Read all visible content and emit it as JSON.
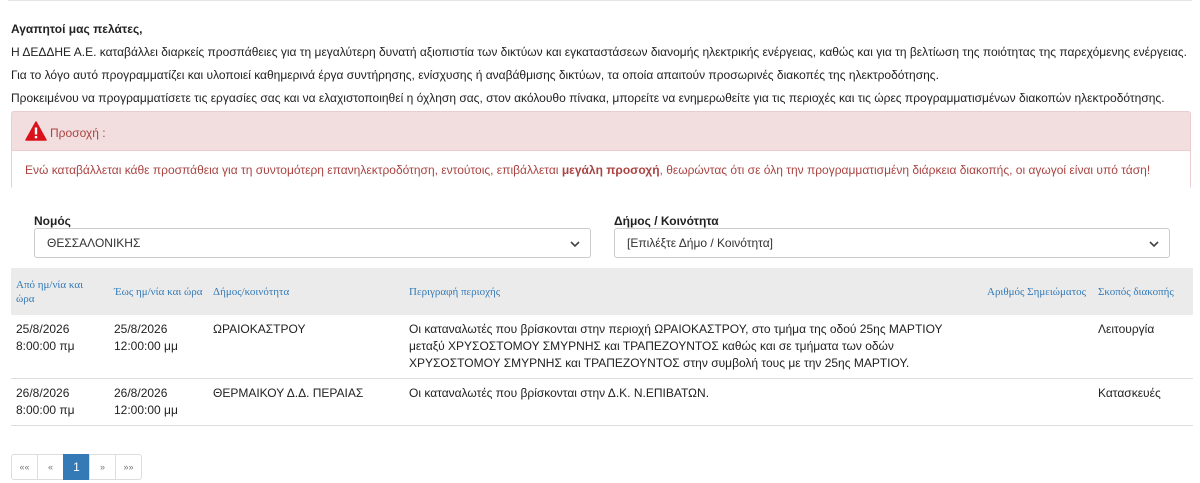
{
  "intro": {
    "greeting": "Αγαπητοί μας πελάτες,",
    "p1": "Η ΔΕΔΔΗΕ Α.Ε. καταβάλλει διαρκείς προσπάθειες για τη μεγαλύτερη δυνατή αξιοπιστία των δικτύων και εγκαταστάσεων διανομής ηλεκτρικής ενέργειας, καθώς και για τη βελτίωση της ποιότητας της παρεχόμενης ενέργειας.",
    "p2": "Για το λόγο αυτό προγραμματίζει και υλοποιεί καθημερινά έργα συντήρησης, ενίσχυσης ή αναβάθμισης δικτύων, τα οποία απαιτούν προσωρινές διακοπές της ηλεκτροδότησης.",
    "p3": "Προκειμένου να προγραμματίσετε τις εργασίες σας και να ελαχιστοποιηθεί η όχληση σας, στον ακόλουθο πίνακα, μπορείτε να ενημερωθείτε για τις περιοχές και τις ώρες προγραμματισμένων διακοπών ηλεκτροδότησης."
  },
  "alert": {
    "icon": "warning-icon",
    "title": "Προσοχή :",
    "msg_before": "Ενώ καταβάλλεται κάθε προσπάθεια για τη συντομότερη επανηλεκτροδότηση, εντούτοις, επιβάλλεται ",
    "msg_bold": "μεγάλη προσοχή",
    "msg_after": ", θεωρώντας ότι σε όλη την προγραμματισμένη διάρκεια διακοπής, οι αγωγοί είναι υπό τάση!"
  },
  "filters": {
    "prefecture_label": "Νομός",
    "prefecture_value": "ΘΕΣΣΑΛΟΝΙΚΗΣ",
    "municipality_label": "Δήμος / Κοινότητα",
    "municipality_value": "[Επιλέξτε Δήμο / Κοινότητα]"
  },
  "table": {
    "headers": [
      "Από ημ/νία και ώρα",
      "Έως ημ/νία και ώρα",
      "Δήμος/κοινότητα",
      "Περιγραφή περιοχής",
      "Αριθμός Σημειώματος",
      "Σκοπός διακοπής"
    ],
    "rows": [
      {
        "from_date": "25/8/2026",
        "from_time": "8:00:00 πμ",
        "to_date": "25/8/2026",
        "to_time": "12:00:00 μμ",
        "municipality": "ΩΡΑΙΟΚΑΣΤΡΟΥ",
        "description": "Οι καταναλωτές που βρίσκονται στην περιοχή ΩΡΑΙΟΚΑΣΤΡΟΥ, στο τμήμα της οδού 25ης ΜΑΡΤΙΟΥ μεταξύ ΧΡΥΣΟΣΤΟΜΟΥ ΣΜΥΡΝΗΣ και ΤΡΑΠΕΖΟΥΝΤΟΣ καθώς και σε τμήματα των οδών ΧΡΥΣΟΣΤΟΜΟΥ ΣΜΥΡΝΗΣ και ΤΡΑΠΕΖΟΥΝΤΟΣ στην συμβολή τους με την 25ης ΜΑΡΤΙΟΥ.",
        "note_no": "",
        "purpose": "Λειτουργία"
      },
      {
        "from_date": "26/8/2026",
        "from_time": "8:00:00 πμ",
        "to_date": "26/8/2026",
        "to_time": "12:00:00 μμ",
        "municipality": "ΘΕΡΜΑΙΚΟΥ Δ.Δ. ΠΕΡΑΙΑΣ",
        "description": "Οι καταναλωτές που βρίσκονται στην Δ.Κ. Ν.ΕΠΙΒΑΤΩΝ.",
        "note_no": "",
        "purpose": "Κατασκευές"
      }
    ]
  },
  "pager": {
    "first": "««",
    "prev": "«",
    "current": "1",
    "next": "»",
    "last": "»»"
  }
}
